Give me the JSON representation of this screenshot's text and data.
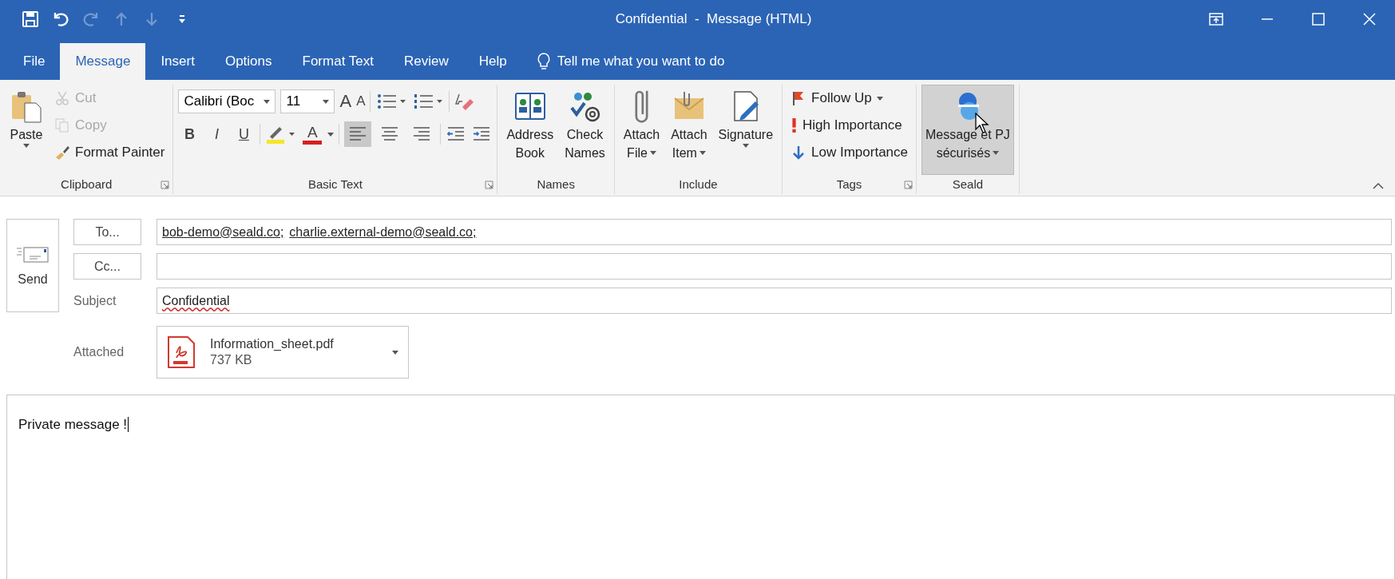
{
  "window": {
    "title": "Confidential  -  Message (HTML)",
    "quick_access": [
      {
        "disabled": false
      },
      {
        "disabled": false
      },
      {
        "disabled": true
      },
      {
        "disabled": true
      },
      {
        "disabled": true
      },
      {
        "disabled": false
      }
    ]
  },
  "tabs": [
    {
      "label": "File",
      "selected": false
    },
    {
      "label": "Message",
      "selected": true
    },
    {
      "label": "Insert",
      "selected": false
    },
    {
      "label": "Options",
      "selected": false
    },
    {
      "label": "Format Text",
      "selected": false
    },
    {
      "label": "Review",
      "selected": false
    },
    {
      "label": "Help",
      "selected": false
    }
  ],
  "tell_me": {
    "placeholder": "Tell me what you want to do"
  },
  "ribbon": {
    "groups": [
      {
        "name": "Clipboard",
        "launcher": true,
        "columns": [
          {
            "kind": "large",
            "lines": [
              "Paste"
            ],
            "dropdown": true,
            "hovered": false
          },
          {
            "kind": "stack",
            "items": [
              {
                "label": "Cut",
                "disabled": true,
                "dropdown": false
              },
              {
                "label": "Copy",
                "disabled": true,
                "dropdown": false
              },
              {
                "label": "Format Painter",
                "disabled": false,
                "dropdown": false
              }
            ]
          }
        ]
      },
      {
        "name": "Basic Text",
        "launcher": true,
        "columns": [
          {
            "kind": "font",
            "font": "Calibri (Boc",
            "size": "11",
            "grow": "A",
            "shrink": "A",
            "styles": [
              "B",
              "I",
              "U"
            ],
            "color_letter": "A",
            "alignment": [
              {
                "selected": true
              },
              {
                "selected": false
              },
              {
                "selected": false
              }
            ]
          }
        ]
      },
      {
        "name": "Names",
        "launcher": false,
        "columns": [
          {
            "kind": "large",
            "lines": [
              "Address",
              "Book"
            ],
            "dropdown": false,
            "hovered": false
          },
          {
            "kind": "large",
            "lines": [
              "Check",
              "Names"
            ],
            "dropdown": false,
            "hovered": false
          }
        ]
      },
      {
        "name": "Include",
        "launcher": false,
        "columns": [
          {
            "kind": "large",
            "lines": [
              "Attach",
              "File"
            ],
            "dropdown": true,
            "hovered": false
          },
          {
            "kind": "large",
            "lines": [
              "Attach",
              "Item"
            ],
            "dropdown": true,
            "hovered": false
          },
          {
            "kind": "large",
            "lines": [
              "Signature"
            ],
            "dropdown": true,
            "hovered": false
          }
        ]
      },
      {
        "name": "Tags",
        "launcher": true,
        "columns": [
          {
            "kind": "stack",
            "items": [
              {
                "label": "Follow Up",
                "disabled": false,
                "dropdown": true
              },
              {
                "label": "High Importance",
                "disabled": false,
                "dropdown": false
              },
              {
                "label": "Low Importance",
                "disabled": false,
                "dropdown": false
              }
            ]
          }
        ]
      },
      {
        "name": "Seald",
        "launcher": false,
        "columns": [
          {
            "kind": "large",
            "lines": [
              "Message et PJ",
              "sécurisés"
            ],
            "dropdown": true,
            "hovered": true
          }
        ]
      }
    ]
  },
  "compose": {
    "send": "Send",
    "to": {
      "button": "To...",
      "recipients": [
        "bob-demo@seald.co;",
        "charlie.external-demo@seald.co;"
      ]
    },
    "cc": {
      "button": "Cc..."
    },
    "subject": {
      "label": "Subject",
      "value": "Confidential"
    },
    "attachment": {
      "label": "Attached",
      "name": "Information_sheet.pdf",
      "size": "737 KB"
    },
    "body": "Private message !"
  }
}
